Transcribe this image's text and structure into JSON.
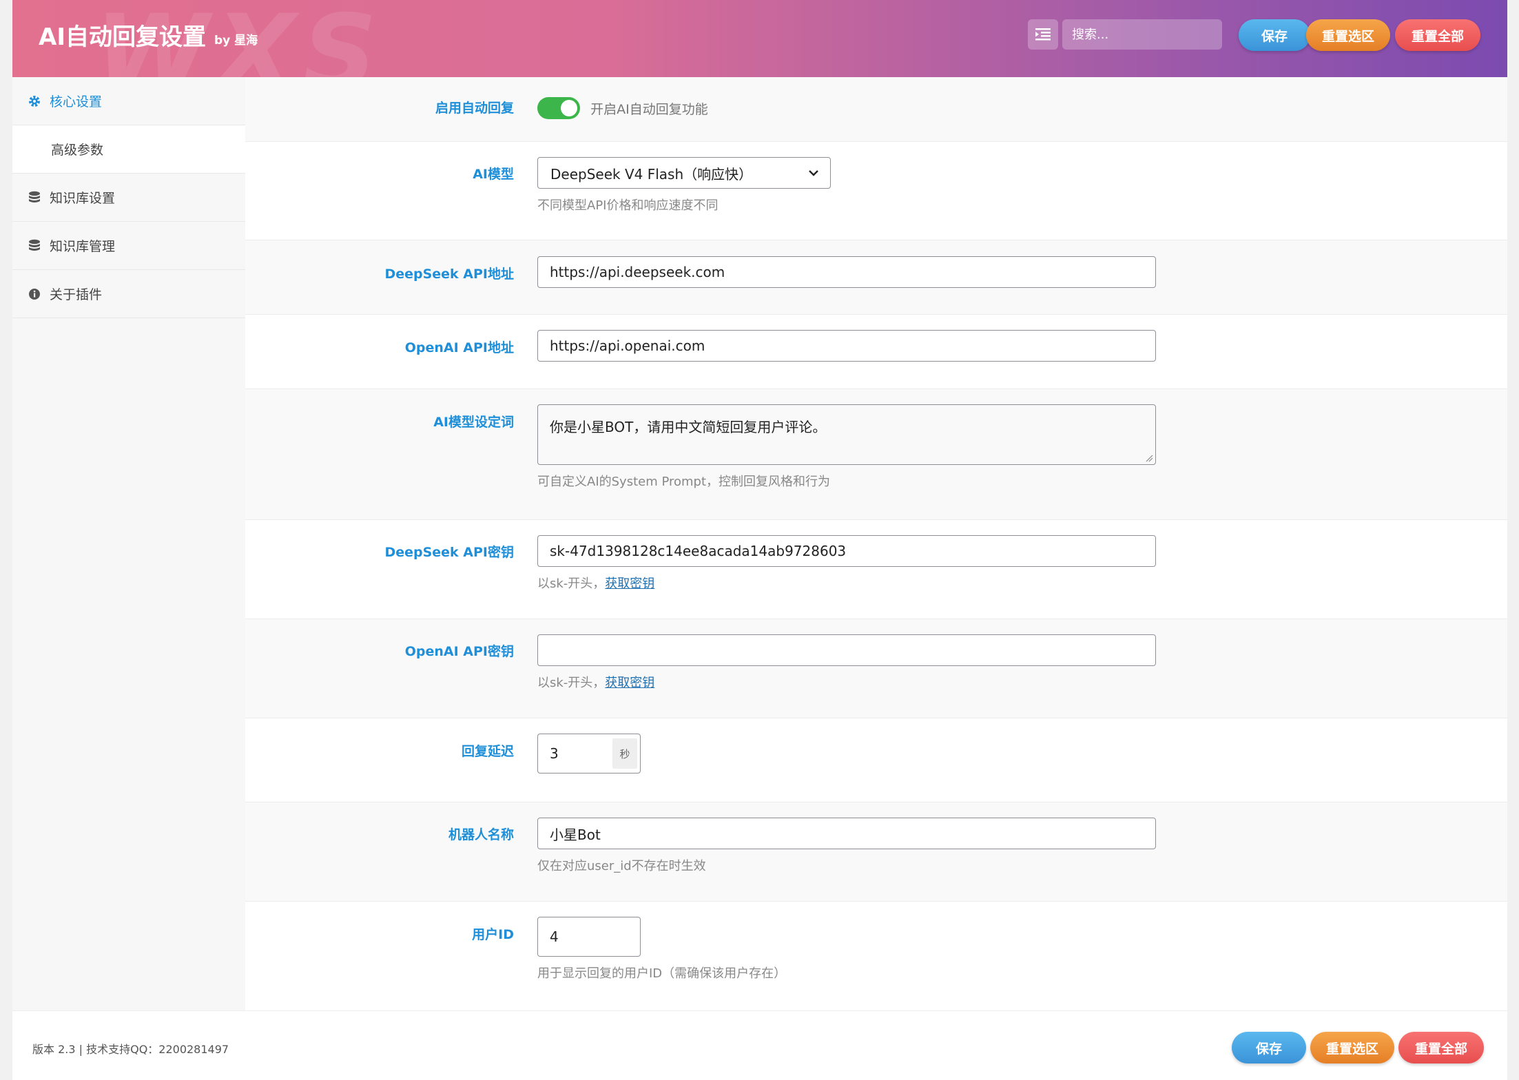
{
  "header": {
    "title": "AI自动回复设置",
    "by": "by 星海",
    "watermark": "WXS",
    "search_placeholder": "搜索...",
    "buttons": {
      "save": "保存",
      "reset_section": "重置选区",
      "reset_all": "重置全部"
    }
  },
  "sidebar": {
    "items": [
      {
        "label": "核心设置",
        "icon": "gear-icon",
        "active": true
      },
      {
        "label": "高级参数",
        "icon": "",
        "active": false
      },
      {
        "label": "知识库设置",
        "icon": "database-icon",
        "active": false
      },
      {
        "label": "知识库管理",
        "icon": "database-icon",
        "active": false
      },
      {
        "label": "关于插件",
        "icon": "info-icon",
        "active": false
      }
    ]
  },
  "settings": {
    "enable": {
      "label": "启用自动回复",
      "text": "开启AI自动回复功能",
      "on": true
    },
    "model": {
      "label": "AI模型",
      "value": "DeepSeek V4 Flash（响应快）",
      "desc": "不同模型API价格和响应速度不同"
    },
    "deepseek_url": {
      "label": "DeepSeek API地址",
      "value": "https://api.deepseek.com"
    },
    "openai_url": {
      "label": "OpenAI API地址",
      "value": "https://api.openai.com"
    },
    "prompt": {
      "label": "AI模型设定词",
      "value": "你是小星BOT，请用中文简短回复用户评论。",
      "desc": "可自定义AI的System Prompt，控制回复风格和行为"
    },
    "deepseek_key": {
      "label": "DeepSeek API密钥",
      "value": "sk-47d1398128c14ee8acada14ab9728603",
      "desc": "以sk-开头，",
      "link": "获取密钥"
    },
    "openai_key": {
      "label": "OpenAI API密钥",
      "value": "",
      "desc": "以sk-开头，",
      "link": "获取密钥"
    },
    "delay": {
      "label": "回复延迟",
      "value": "3",
      "unit": "秒"
    },
    "bot_name": {
      "label": "机器人名称",
      "value": "小星Bot",
      "desc": "仅在对应user_id不存在时生效"
    },
    "user_id": {
      "label": "用户ID",
      "value": "4",
      "desc": "用于显示回复的用户ID（需确保该用户存在）"
    }
  },
  "footer": {
    "version": "版本 2.3 | 技术支持QQ：2200281497",
    "buttons": {
      "save": "保存",
      "reset_section": "重置选区",
      "reset_all": "重置全部"
    }
  },
  "colors": {
    "accent": "#1e8fd8",
    "toggle_on": "#3cb54a",
    "header_start": "#e2708f",
    "header_end": "#7c4bb0"
  }
}
